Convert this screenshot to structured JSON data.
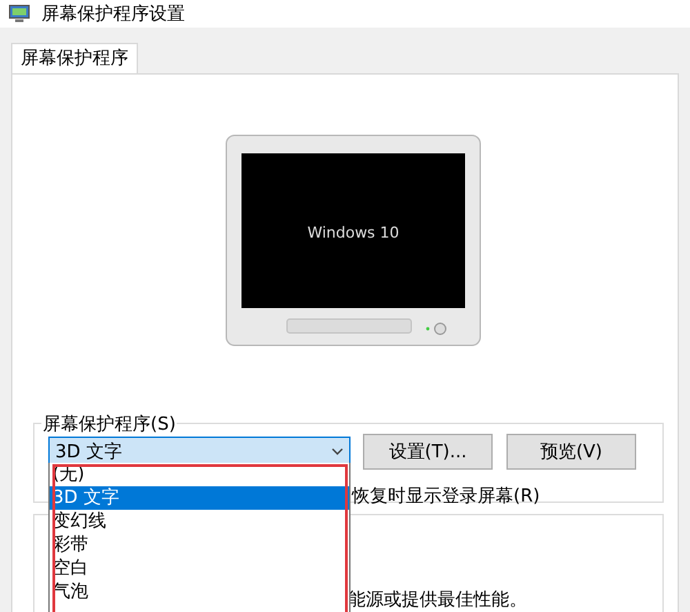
{
  "window": {
    "title": "屏幕保护程序设置"
  },
  "tabs": [
    {
      "label": "屏幕保护程序",
      "selected": true
    }
  ],
  "preview": {
    "screen_text": "Windows 10"
  },
  "screensaver_group": {
    "label": "屏幕保护程序(S)",
    "combo_value": "3D 文字",
    "buttons": [
      "设置(T)...",
      "预览(V)"
    ],
    "checkbox_label": "恢复时显示登录屏幕(R)"
  },
  "power_group": {
    "text": "能源或提供最佳性能。"
  },
  "dropdown": {
    "items": [
      {
        "label": "(无)",
        "selected": false
      },
      {
        "label": "3D 文字",
        "selected": true
      },
      {
        "label": "变幻线",
        "selected": false
      },
      {
        "label": "彩带",
        "selected": false
      },
      {
        "label": "空白",
        "selected": false
      },
      {
        "label": "气泡",
        "selected": false
      }
    ]
  }
}
